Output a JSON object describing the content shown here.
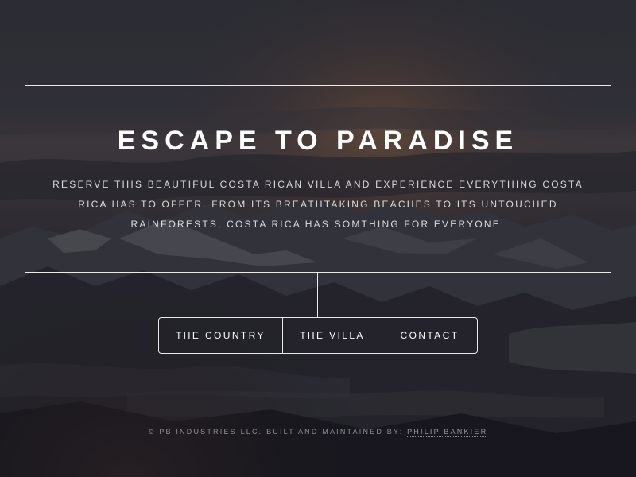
{
  "hero": {
    "title": "ESCAPE TO PARADISE",
    "tagline": "RESERVE THIS BEAUTIFUL COSTA RICAN VILLA AND EXPERIENCE EVERYTHING COSTA RICA HAS TO OFFER. FROM ITS BREATHTAKING BEACHES TO ITS UNTOUCHED RAINFORESTS, COSTA RICA HAS SOMTHING FOR EVERYONE."
  },
  "nav": {
    "items": [
      {
        "label": "THE COUNTRY"
      },
      {
        "label": "THE VILLA"
      },
      {
        "label": "CONTACT"
      }
    ]
  },
  "footer": {
    "text": "© PB INDUSTRIES LLC. BUILT AND MAINTAINED BY: ",
    "author_link": "PHILIP BANKIER"
  },
  "colors": {
    "text": "#ffffff",
    "background_dark": "#1c1b21",
    "sky": "#35363c",
    "sunset_glow": "#8a5a36"
  }
}
